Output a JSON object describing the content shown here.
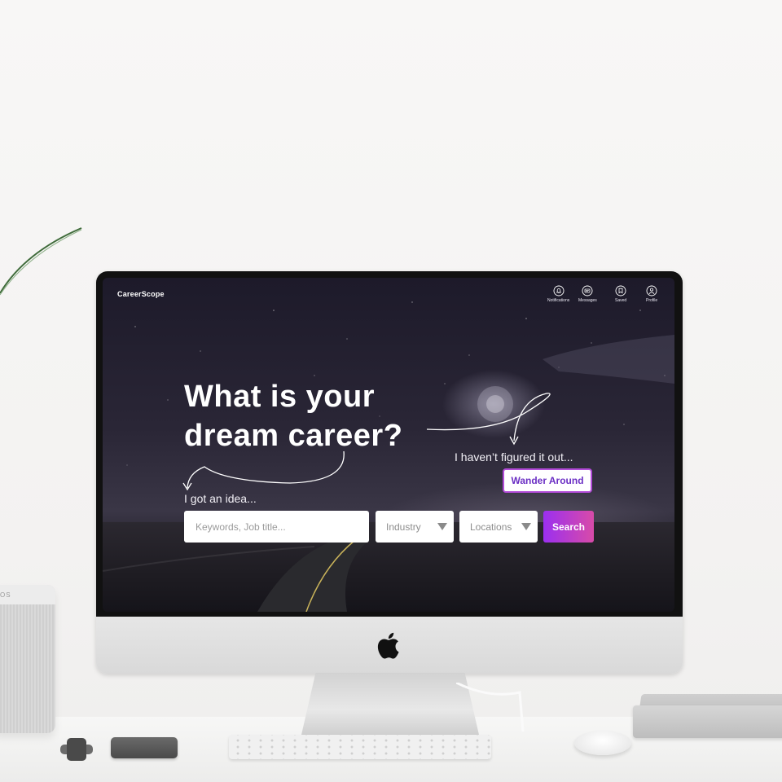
{
  "app": {
    "brand": "CareerScope"
  },
  "nav": {
    "items": [
      {
        "label": "Notifications",
        "icon": "bell-icon"
      },
      {
        "label": "Messages",
        "icon": "message-icon"
      },
      {
        "label": "Saved",
        "icon": "bookmark-icon"
      },
      {
        "label": "Profile",
        "icon": "user-icon"
      }
    ]
  },
  "hero": {
    "headline_line1": "What is your",
    "headline_line2": "dream career?",
    "idea_label": "I got an idea...",
    "figured_label": "I haven’t figured it out...",
    "wander_button": "Wander Around"
  },
  "search": {
    "keywords_placeholder": "Keywords, Job title...",
    "industry_value": "Industry",
    "locations_value": "Locations",
    "search_button": "Search"
  },
  "speaker": {
    "brand_fragment": "OS"
  },
  "colors": {
    "accent_purple": "#9b2ff0",
    "accent_pink": "#d84ba8",
    "wander_text": "#6b2fc4"
  }
}
